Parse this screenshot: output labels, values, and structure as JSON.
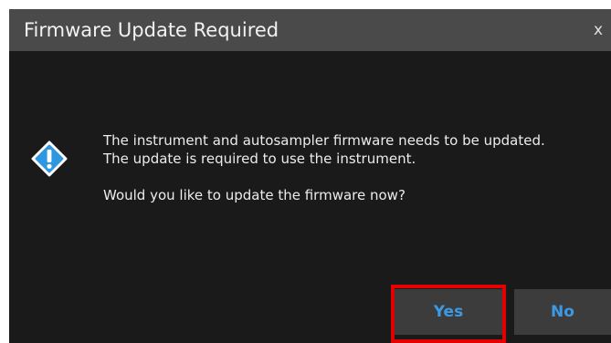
{
  "dialog": {
    "title": "Firmware Update Required",
    "close_label": "x",
    "icon": "warning-exclamation-icon",
    "message": {
      "line1": "The instrument and autosampler firmware needs to be updated.",
      "line2": "The update is required to use the instrument.",
      "line3": "Would you like to update the firmware now?"
    },
    "buttons": {
      "yes_label": "Yes",
      "no_label": "No"
    }
  },
  "colors": {
    "background": "#1a1a1a",
    "titlebar": "#4a4a4a",
    "button_bg": "#3c3c3c",
    "button_text": "#3b9ae6",
    "icon": "#2f97e0",
    "highlight_box": "#e30000"
  }
}
